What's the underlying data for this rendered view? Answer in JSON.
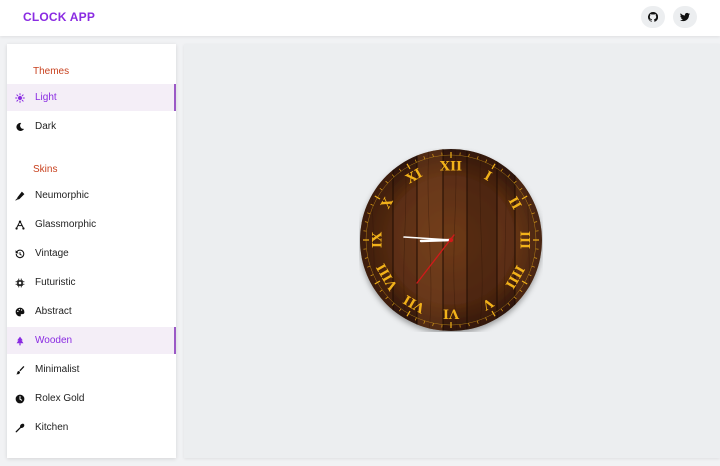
{
  "app": {
    "title": "CLOCK APP"
  },
  "header": {
    "github_icon": "github-icon",
    "twitter_icon": "twitter-icon"
  },
  "sidebar": {
    "themes_heading": "Themes",
    "themes": [
      {
        "label": "Light",
        "icon": "sun-icon",
        "active": true
      },
      {
        "label": "Dark",
        "icon": "moon-icon",
        "active": false
      }
    ],
    "skins_heading": "Skins",
    "skins": [
      {
        "label": "Neumorphic",
        "icon": "pen-icon",
        "active": false
      },
      {
        "label": "Glassmorphic",
        "icon": "vector-icon",
        "active": false
      },
      {
        "label": "Vintage",
        "icon": "history-icon",
        "active": false
      },
      {
        "label": "Futuristic",
        "icon": "chip-icon",
        "active": false
      },
      {
        "label": "Abstract",
        "icon": "palette-icon",
        "active": false
      },
      {
        "label": "Wooden",
        "icon": "tree-icon",
        "active": true
      },
      {
        "label": "Minimalist",
        "icon": "brush-icon",
        "active": false
      },
      {
        "label": "Rolex Gold",
        "icon": "clock-icon",
        "active": false
      },
      {
        "label": "Kitchen",
        "icon": "spoon-icon",
        "active": false
      }
    ]
  },
  "clock": {
    "skin": "Wooden",
    "numerals": [
      "XII",
      "I",
      "II",
      "III",
      "IIII",
      "V",
      "VI",
      "VII",
      "VIII",
      "IX",
      "X",
      "XI"
    ],
    "colors": {
      "accent": "#8a2be2",
      "numeral": "#f2b21a",
      "wood": "#5a2f14",
      "second_hand": "#d11a1a",
      "hands": "#ffffff"
    }
  }
}
